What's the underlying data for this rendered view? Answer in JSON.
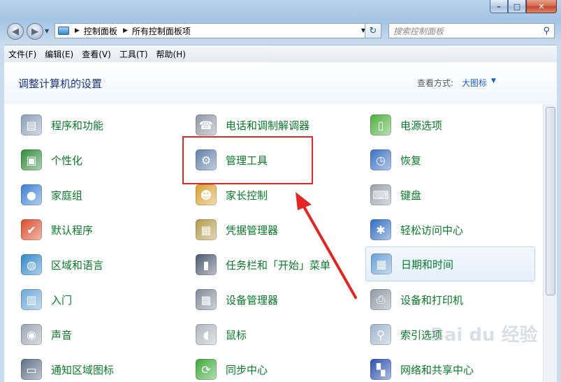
{
  "window": {
    "minimize_glyph": "–",
    "maximize_glyph": "□",
    "close_glyph": "✕"
  },
  "nav": {
    "back_glyph": "◀",
    "forward_glyph": "▶",
    "breadcrumbs": [
      "控制面板",
      "所有控制面板项"
    ],
    "search_placeholder": "搜索控制面板"
  },
  "menu": [
    "文件(F)",
    "编辑(E)",
    "查看(V)",
    "工具(T)",
    "帮助(H)"
  ],
  "page": {
    "title": "调整计算机的设置",
    "view_label": "查看方式:",
    "view_value": "大图标"
  },
  "items": {
    "col1": [
      {
        "label": "程序和功能",
        "icon": "programs-icon",
        "color": "#8a9fb8"
      },
      {
        "label": "个性化",
        "icon": "personalize-icon",
        "color": "#2f8a3a"
      },
      {
        "label": "家庭组",
        "icon": "homegroup-icon",
        "color": "#3a7fd0"
      },
      {
        "label": "默认程序",
        "icon": "default-programs-icon",
        "color": "#d94a2a"
      },
      {
        "label": "区域和语言",
        "icon": "region-icon",
        "color": "#2f86c8"
      },
      {
        "label": "入门",
        "icon": "getting-started-icon",
        "color": "#6aa6d8"
      },
      {
        "label": "声音",
        "icon": "sound-icon",
        "color": "#9aa5b2"
      },
      {
        "label": "通知区域图标",
        "icon": "notification-icon",
        "color": "#5d6f85"
      }
    ],
    "col2": [
      {
        "label": "电话和调制解调器",
        "icon": "phone-modem-icon",
        "color": "#8d97a3"
      },
      {
        "label": "管理工具",
        "icon": "admin-tools-icon",
        "color": "#5f7fa8"
      },
      {
        "label": "家长控制",
        "icon": "parental-control-icon",
        "color": "#d8a030"
      },
      {
        "label": "凭据管理器",
        "icon": "credential-icon",
        "color": "#b39a4a"
      },
      {
        "label": "任务栏和「开始」菜单",
        "icon": "taskbar-icon",
        "color": "#4a5a70"
      },
      {
        "label": "设备管理器",
        "icon": "device-manager-icon",
        "color": "#7f8b99"
      },
      {
        "label": "鼠标",
        "icon": "mouse-icon",
        "color": "#b0b6bf"
      },
      {
        "label": "同步中心",
        "icon": "sync-icon",
        "color": "#3ca83a"
      }
    ],
    "col3": [
      {
        "label": "电源选项",
        "icon": "power-icon",
        "color": "#4caf3a"
      },
      {
        "label": "恢复",
        "icon": "recovery-icon",
        "color": "#3a6fc0"
      },
      {
        "label": "键盘",
        "icon": "keyboard-icon",
        "color": "#9aa1aa"
      },
      {
        "label": "轻松访问中心",
        "icon": "ease-access-icon",
        "color": "#2e6cc0"
      },
      {
        "label": "日期和时间",
        "icon": "datetime-icon",
        "color": "#6a9fd6"
      },
      {
        "label": "设备和打印机",
        "icon": "printer-icon",
        "color": "#8e98a6"
      },
      {
        "label": "索引选项",
        "icon": "index-icon",
        "color": "#9fb6cc"
      },
      {
        "label": "网络和共享中心",
        "icon": "network-icon",
        "color": "#2a4fb0"
      }
    ]
  },
  "annotation": {
    "highlight_color": "#e22626"
  },
  "watermark": "Bai du 经验"
}
